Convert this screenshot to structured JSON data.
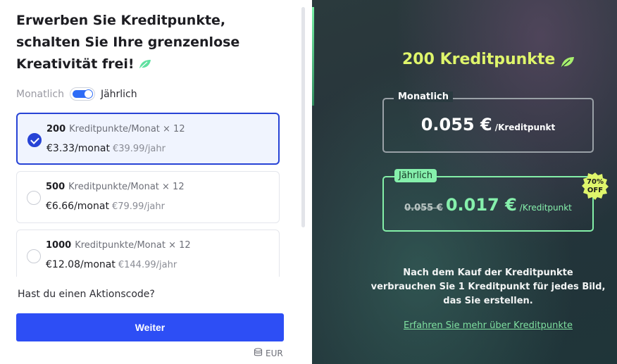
{
  "heading": {
    "line1": "Erwerben Sie Kreditpunkte,",
    "line2": "schalten Sie Ihre grenzenlose",
    "line3": "Kreativität frei!"
  },
  "billing_toggle": {
    "off_label": "Monatlich",
    "on_label": "Jährlich",
    "selected": "Jährlich"
  },
  "plans": [
    {
      "count": "200",
      "label": "Kreditpunkte/Monat × 12",
      "monthly": "€3.33/monat",
      "yearly": "€39.99/jahr",
      "selected": true
    },
    {
      "count": "500",
      "label": "Kreditpunkte/Monat × 12",
      "monthly": "€6.66/monat",
      "yearly": "€79.99/jahr",
      "selected": false
    },
    {
      "count": "1000",
      "label": "Kreditpunkte/Monat × 12",
      "monthly": "€12.08/monat",
      "yearly": "€144.99/jahr",
      "selected": false
    }
  ],
  "promo_text": "Hast du einen Aktionscode?",
  "continue_button": "Weiter",
  "currency": "EUR",
  "summary": {
    "title": "200 Kreditpunkte",
    "monthly_label": "Monatlich",
    "monthly_price": "0.055 €",
    "per_unit": "/Kreditpunkt",
    "yearly_label": "Jährlich",
    "yearly_old_price": "0.055 €",
    "yearly_price": "0.017 €",
    "discount_percent": "70%",
    "discount_word": "OFF",
    "info_line1": "Nach dem Kauf der Kreditpunkte",
    "info_line2": "verbrauchen Sie 1 Kreditpunkt für jedes Bild,",
    "info_line3": "das Sie erstellen.",
    "learn_more": "Erfahren Sie mehr über Kreditpunkte"
  },
  "colors": {
    "accent_blue": "#2d4ef5",
    "accent_green": "#86f0ac",
    "title_yellow": "#dff56b",
    "dark_panel": "#26333a"
  },
  "icons": [
    "leaf-icon",
    "check-icon",
    "database-icon",
    "discount-badge-icon"
  ]
}
